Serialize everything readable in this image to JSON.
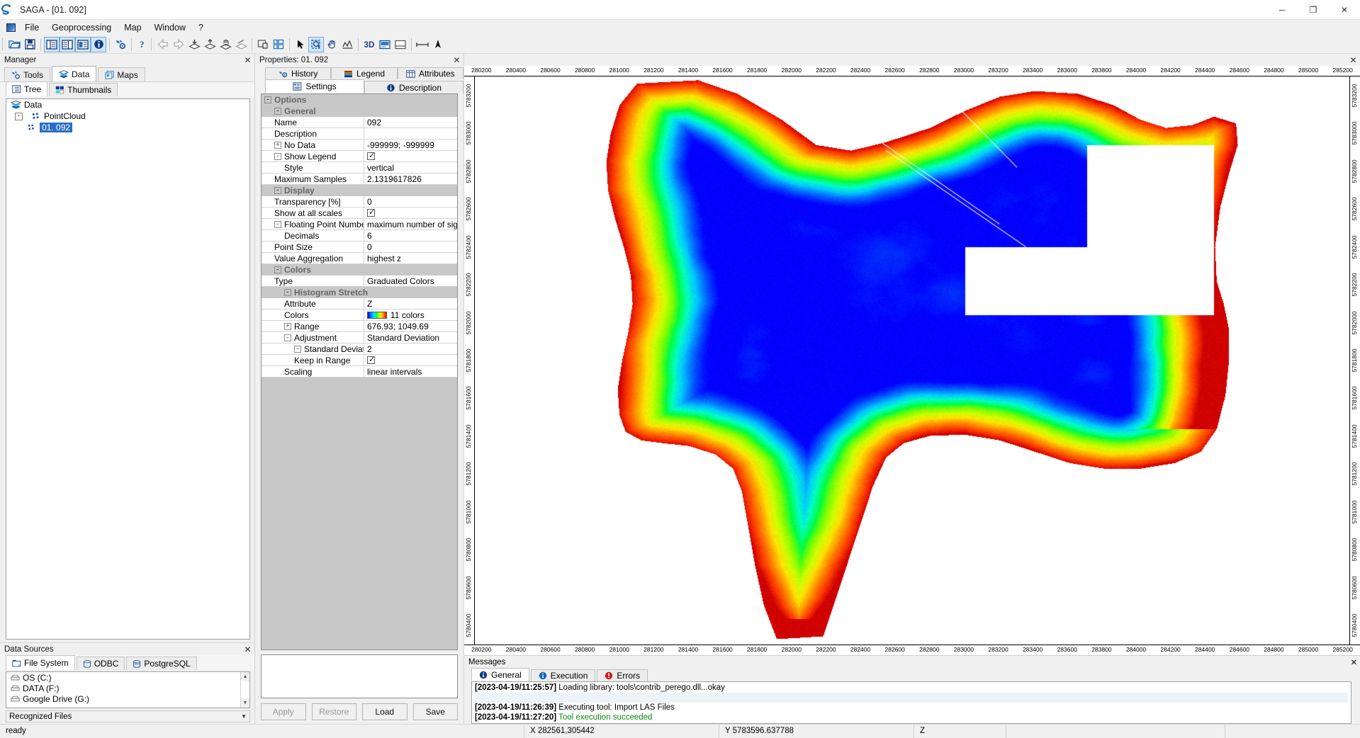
{
  "window": {
    "title": "SAGA - [01. 092]",
    "app_icon": "saga-logo-icon",
    "minimize": "─",
    "maximize": "❐",
    "close": "✕"
  },
  "menubar": {
    "items": [
      "File",
      "Geoprocessing",
      "Map",
      "Window",
      "?"
    ]
  },
  "toolbar": {
    "groups": [
      [
        "open-folder-icon",
        "save-icon"
      ],
      [
        "show-tool-manager-icon",
        "show-data-manager-icon",
        "show-maps-manager-icon",
        "show-properties-icon"
      ],
      [
        "tool-library-icon"
      ],
      [
        "help-icon"
      ],
      [
        "back-arrow-icon",
        "forward-arrow-icon",
        "load-layer-icon",
        "save-layer-icon",
        "pan-layer-icon",
        "clear-layer-icon"
      ],
      [
        "lock-window-icon",
        "tile-windows-icon"
      ],
      [
        "pointer-icon",
        "zoom-select-icon",
        "pan-hand-icon",
        "measure-distance-icon"
      ],
      [
        "3d-view-icon",
        "scatterplot-icon",
        "legend-window-icon"
      ],
      [
        "ruler-icon",
        "north-arrow-icon"
      ]
    ]
  },
  "manager": {
    "caption": "Manager",
    "close_label": "✕",
    "tabs": [
      {
        "label": "Tools",
        "icon": "tools-icon",
        "selected": false
      },
      {
        "label": "Data",
        "icon": "data-layers-icon",
        "selected": true
      },
      {
        "label": "Maps",
        "icon": "maps-icon",
        "selected": false
      }
    ],
    "subtabs": [
      {
        "label": "Tree",
        "icon": "tree-view-icon",
        "selected": true
      },
      {
        "label": "Thumbnails",
        "icon": "thumbnails-icon",
        "selected": false
      }
    ],
    "tree": [
      {
        "label": "Data",
        "icon": "data-layers-icon",
        "depth": 0,
        "expander": "",
        "selected": false
      },
      {
        "label": "PointCloud",
        "icon": "pointcloud-icon",
        "depth": 1,
        "expander": "-",
        "selected": false
      },
      {
        "label": "01. 092",
        "icon": "pointcloud-item-icon",
        "depth": 2,
        "expander": "",
        "selected": true
      }
    ]
  },
  "datasources": {
    "caption": "Data Sources",
    "close_label": "✕",
    "tabs": [
      {
        "label": "File System",
        "icon": "file-system-icon",
        "selected": true
      },
      {
        "label": "ODBC",
        "icon": "odbc-icon",
        "selected": false
      },
      {
        "label": "PostgreSQL",
        "icon": "postgresql-icon",
        "selected": false
      }
    ],
    "items": [
      {
        "label": "OS (C:)",
        "icon": "drive-icon"
      },
      {
        "label": "DATA (F:)",
        "icon": "drive-icon"
      },
      {
        "label": "Google Drive (G:)",
        "icon": "drive-icon"
      }
    ],
    "recognized_files_label": "Recognized Files",
    "recognized_chevron": "▼",
    "scroll_up": "▲",
    "scroll_down": "▼"
  },
  "properties": {
    "caption": "Properties: 01. 092",
    "close_label": "✕",
    "tabs_row1": [
      {
        "label": "History",
        "icon": "history-icon",
        "selected": false
      },
      {
        "label": "Legend",
        "icon": "legend-bars-icon",
        "selected": false
      },
      {
        "label": "Attributes",
        "icon": "attributes-table-icon",
        "selected": false
      }
    ],
    "tabs_row2": [
      {
        "label": "Settings",
        "icon": "settings-icon",
        "selected": true
      },
      {
        "label": "Description",
        "icon": "description-icon",
        "selected": false
      }
    ],
    "rows": [
      {
        "kind": "group",
        "label": "Options",
        "indent": 0,
        "expander": "-"
      },
      {
        "kind": "group",
        "label": "General",
        "indent": 1,
        "expander": "-"
      },
      {
        "kind": "prop",
        "label": "Name",
        "value": "092",
        "indent": 1,
        "expander": "",
        "type": "text"
      },
      {
        "kind": "prop",
        "label": "Description",
        "value": "",
        "indent": 1,
        "expander": "",
        "type": "text"
      },
      {
        "kind": "prop",
        "label": "No Data",
        "value": "-999999; -999999",
        "indent": 1,
        "expander": "+",
        "type": "text"
      },
      {
        "kind": "prop",
        "label": "Show Legend",
        "value": "",
        "indent": 1,
        "expander": "-",
        "type": "checkbox",
        "checked": true
      },
      {
        "kind": "prop",
        "label": "Style",
        "value": "vertical",
        "indent": 2,
        "expander": "",
        "type": "text"
      },
      {
        "kind": "prop",
        "label": "Maximum Samples",
        "value": "2.1319617826",
        "indent": 1,
        "expander": "",
        "type": "text"
      },
      {
        "kind": "group",
        "label": "Display",
        "indent": 1,
        "expander": "-"
      },
      {
        "kind": "prop",
        "label": "Transparency [%]",
        "value": "0",
        "indent": 1,
        "expander": "",
        "type": "text"
      },
      {
        "kind": "prop",
        "label": "Show at all scales",
        "value": "",
        "indent": 1,
        "expander": "",
        "type": "checkbox",
        "checked": true
      },
      {
        "kind": "prop",
        "label": "Floating Point Numbers",
        "value": "maximum number of significant",
        "indent": 1,
        "expander": "-",
        "type": "text"
      },
      {
        "kind": "prop",
        "label": "Decimals",
        "value": "6",
        "indent": 2,
        "expander": "",
        "type": "text"
      },
      {
        "kind": "prop",
        "label": "Point Size",
        "value": "0",
        "indent": 1,
        "expander": "",
        "type": "text"
      },
      {
        "kind": "prop",
        "label": "Value Aggregation",
        "value": "highest z",
        "indent": 1,
        "expander": "",
        "type": "text"
      },
      {
        "kind": "group",
        "label": "Colors",
        "indent": 1,
        "expander": "-"
      },
      {
        "kind": "prop",
        "label": "Type",
        "value": "Graduated Colors",
        "indent": 1,
        "expander": "",
        "type": "text"
      },
      {
        "kind": "group",
        "label": "Histogram Stretch",
        "indent": 2,
        "expander": "-"
      },
      {
        "kind": "prop",
        "label": "Attribute",
        "value": "Z",
        "indent": 2,
        "expander": "",
        "type": "text"
      },
      {
        "kind": "prop",
        "label": "Colors",
        "value": "11 colors",
        "indent": 2,
        "expander": "",
        "type": "colorramp"
      },
      {
        "kind": "prop",
        "label": "Range",
        "value": "676.93; 1049.69",
        "indent": 2,
        "expander": "+",
        "type": "text"
      },
      {
        "kind": "prop",
        "label": "Adjustment",
        "value": "Standard Deviation",
        "indent": 2,
        "expander": "-",
        "type": "text"
      },
      {
        "kind": "prop",
        "label": "Standard Deviatio",
        "value": "2",
        "indent": 3,
        "expander": "-",
        "type": "text"
      },
      {
        "kind": "prop",
        "label": "Keep in Range",
        "value": "",
        "indent": 3,
        "expander": "",
        "type": "checkbox",
        "checked": true
      },
      {
        "kind": "prop",
        "label": "Scaling",
        "value": "linear intervals",
        "indent": 2,
        "expander": "",
        "type": "text"
      }
    ],
    "buttons": [
      {
        "label": "Apply",
        "enabled": false
      },
      {
        "label": "Restore",
        "enabled": false
      },
      {
        "label": "Load",
        "enabled": true
      },
      {
        "label": "Save",
        "enabled": true
      }
    ]
  },
  "map": {
    "close_label": "✕",
    "x_ticks": [
      "280200",
      "280400",
      "280600",
      "280800",
      "281000",
      "281200",
      "281400",
      "281600",
      "281800",
      "282000",
      "282200",
      "282400",
      "282600",
      "282800",
      "283000",
      "283200",
      "283400",
      "283600",
      "283800",
      "284000",
      "284200",
      "284400",
      "284600",
      "284800",
      "285000",
      "285200"
    ],
    "y_ticks": [
      "5783200",
      "5783000",
      "5782800",
      "5782600",
      "5782400",
      "5782200",
      "5782000",
      "5781800",
      "5781600",
      "5781400",
      "5781200",
      "5781000",
      "5780800",
      "5780600",
      "5780400"
    ],
    "color_ramp": [
      "#0000ff",
      "#0066ff",
      "#00c8ff",
      "#00ffc0",
      "#00ff40",
      "#7cff00",
      "#ccff00",
      "#ffe000",
      "#ff9000",
      "#ff4000",
      "#d00000"
    ]
  },
  "messages": {
    "caption": "Messages",
    "close_label": "✕",
    "tabs": [
      {
        "label": "General",
        "icon": "info-icon",
        "selected": true
      },
      {
        "label": "Execution",
        "icon": "execution-icon",
        "selected": false
      },
      {
        "label": "Errors",
        "icon": "error-icon",
        "selected": false
      }
    ],
    "lines": [
      {
        "timestamp": "[2023-04-19/11:25:57]",
        "text": " Loading library: tools\\contrib_perego.dll...okay",
        "status": "normal"
      },
      {
        "timestamp": "",
        "text": "",
        "status": "normal"
      },
      {
        "timestamp": "[2023-04-19/11:26:39]",
        "text": " Executing tool: Import LAS Files",
        "status": "normal"
      },
      {
        "timestamp": "[2023-04-19/11:27:20]",
        "text": " Tool execution succeeded",
        "status": "success"
      }
    ]
  },
  "statusbar": {
    "ready": "ready",
    "x_label": "X 282561,305442",
    "y_label": "Y 5783596.637788",
    "z_label": "Z",
    "blank1": "",
    "blank2": ""
  }
}
